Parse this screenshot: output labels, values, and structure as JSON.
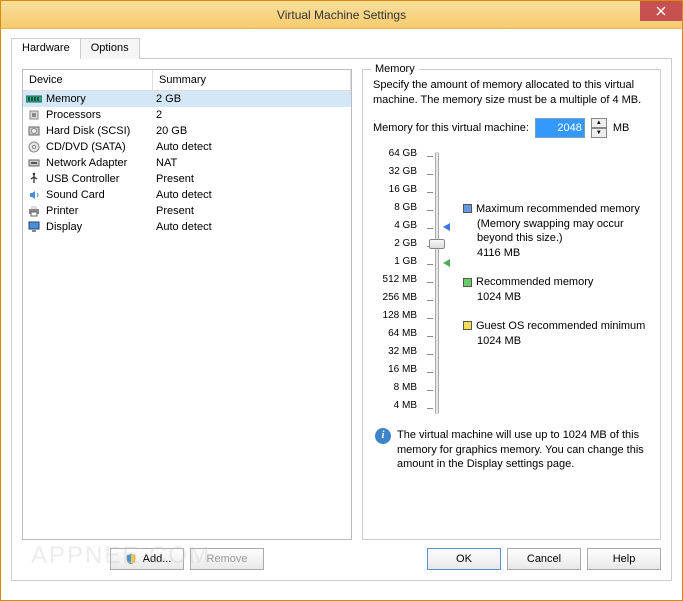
{
  "window": {
    "title": "Virtual Machine Settings"
  },
  "tabs": {
    "hardware": "Hardware",
    "options": "Options"
  },
  "table": {
    "headers": {
      "device": "Device",
      "summary": "Summary"
    },
    "rows": [
      {
        "icon": "memory-icon",
        "device": "Memory",
        "summary": "2 GB"
      },
      {
        "icon": "cpu-icon",
        "device": "Processors",
        "summary": "2"
      },
      {
        "icon": "disk-icon",
        "device": "Hard Disk (SCSI)",
        "summary": "20 GB"
      },
      {
        "icon": "cd-icon",
        "device": "CD/DVD (SATA)",
        "summary": "Auto detect"
      },
      {
        "icon": "network-icon",
        "device": "Network Adapter",
        "summary": "NAT"
      },
      {
        "icon": "usb-icon",
        "device": "USB Controller",
        "summary": "Present"
      },
      {
        "icon": "sound-icon",
        "device": "Sound Card",
        "summary": "Auto detect"
      },
      {
        "icon": "printer-icon",
        "device": "Printer",
        "summary": "Present"
      },
      {
        "icon": "display-icon",
        "device": "Display",
        "summary": "Auto detect"
      }
    ]
  },
  "buttons": {
    "add": "Add...",
    "remove": "Remove",
    "ok": "OK",
    "cancel": "Cancel",
    "help": "Help"
  },
  "memory": {
    "legend": "Memory",
    "desc": "Specify the amount of memory allocated to this virtual machine. The memory size must be a multiple of 4 MB.",
    "input_label": "Memory for this virtual machine:",
    "value": "2048",
    "unit": "MB",
    "ticks": [
      "64 GB",
      "32 GB",
      "16 GB",
      "8 GB",
      "4 GB",
      "2 GB",
      "1 GB",
      "512 MB",
      "256 MB",
      "128 MB",
      "64 MB",
      "32 MB",
      "16 MB",
      "8 MB",
      "4 MB"
    ],
    "max_rec_label": "Maximum recommended memory",
    "max_rec_note": "(Memory swapping may occur beyond this size.)",
    "max_rec_value": "4116 MB",
    "rec_label": "Recommended memory",
    "rec_value": "1024 MB",
    "guest_label": "Guest OS recommended minimum",
    "guest_value": "1024 MB",
    "info": "The virtual machine will use up to 1024 MB of this memory for graphics memory. You can change this amount in the Display settings page."
  },
  "watermark": "APPNEE.COM"
}
